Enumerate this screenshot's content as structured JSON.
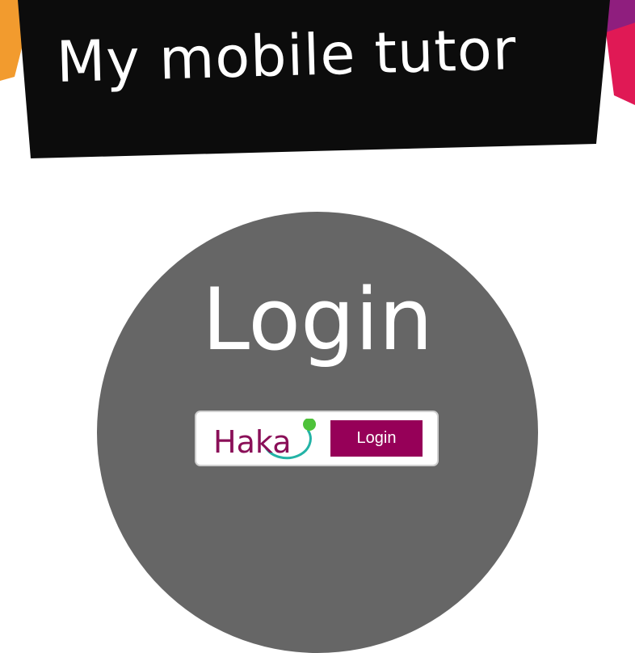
{
  "header": {
    "logo_text": "My mobile tutor"
  },
  "main": {
    "title": "Login",
    "haka": {
      "brand": "Haka",
      "button_label": "Login"
    }
  },
  "colors": {
    "banner_bg": "#0c0c0c",
    "circle_bg": "#666666",
    "haka_brand": "#8a0f58",
    "haka_button": "#960058",
    "haka_ring": "#23b3a6",
    "haka_dot": "#4ec23a"
  },
  "icons": [
    "haka-logo-icon"
  ]
}
